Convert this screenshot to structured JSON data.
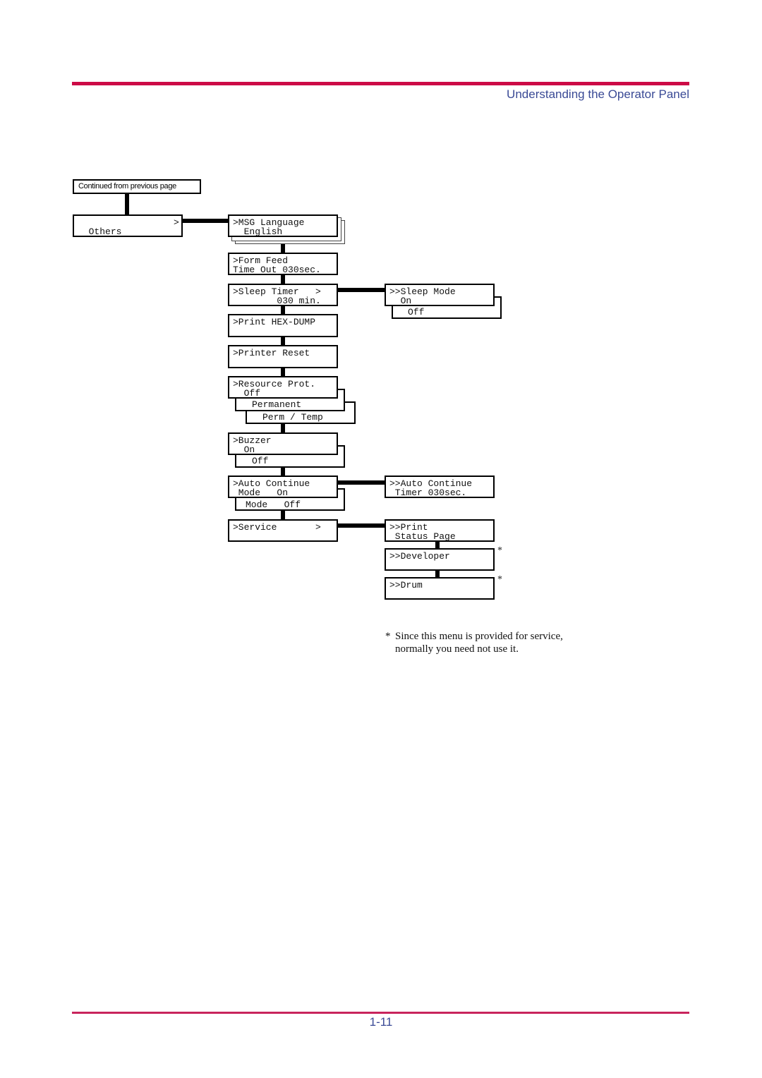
{
  "header": {
    "title": "Understanding the Operator Panel",
    "accent_color": "#cc0a46",
    "title_color": "#3a4a96"
  },
  "footer": {
    "page_number": "1-11"
  },
  "diagram": {
    "continued_label": "Continued from previous page",
    "others": {
      "label": "Others",
      "arrow": ">"
    },
    "menu": {
      "msg_language": {
        "line1": ">MSG Language",
        "line2": "  English"
      },
      "form_feed": {
        "line1": ">Form Feed",
        "line2": "Time Out 030sec."
      },
      "sleep_timer": {
        "line1": ">Sleep Timer   >",
        "line2": "        030 min."
      },
      "print_hex": {
        "line1": ">Print HEX-DUMP"
      },
      "printer_reset": {
        "line1": ">Printer Reset"
      },
      "resource_prot": {
        "line1": ">Resource Prot.",
        "line2": "  Off",
        "options": [
          "Permanent",
          "Perm / Temp"
        ]
      },
      "buzzer": {
        "line1": ">Buzzer",
        "line2": "  On",
        "options": [
          "Off"
        ]
      },
      "auto_continue": {
        "line1": ">Auto Continue",
        "line2": " Mode   On",
        "options": [
          "Mode   Off"
        ]
      },
      "service": {
        "line1": ">Service       >"
      }
    },
    "submenu": {
      "sleep_mode": {
        "line1": ">>Sleep Mode",
        "line2": "  On",
        "options": [
          "Off"
        ]
      },
      "auto_continue_timer": {
        "line1": ">>Auto Continue",
        "line2": " Timer 030sec."
      },
      "print_status": {
        "line1": ">>Print",
        "line2": " Status Page"
      },
      "developer": {
        "line1": ">>Developer",
        "asterisk": "*"
      },
      "drum": {
        "line1": ">>Drum",
        "asterisk": "*"
      }
    },
    "footnote": {
      "mark": "*",
      "line1": "Since this menu is provided for service,",
      "line2": "normally you need not use it."
    }
  }
}
